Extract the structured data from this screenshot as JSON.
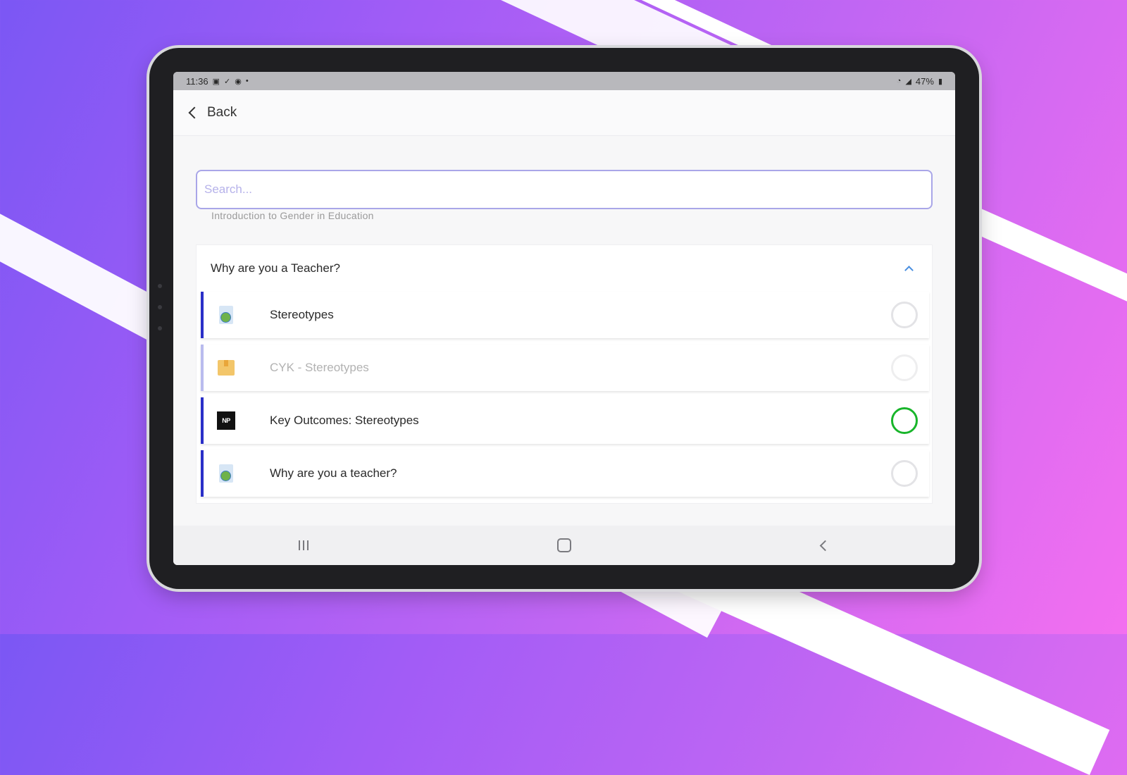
{
  "status_bar": {
    "time": "11:36",
    "battery": "47%"
  },
  "header": {
    "back_label": "Back"
  },
  "search": {
    "placeholder": "Search..."
  },
  "faded_previous_item": "Introduction to Gender in Education",
  "section": {
    "title": "Why are you a Teacher?",
    "items": [
      {
        "label": "Stereotypes",
        "icon": "document-icon",
        "selected": false,
        "dimmed": false
      },
      {
        "label": "CYK - Stereotypes",
        "icon": "package-icon",
        "selected": false,
        "dimmed": true
      },
      {
        "label": "Key Outcomes: Stereotypes",
        "icon": "video-icon",
        "icon_text": "NP",
        "selected": true,
        "dimmed": false
      },
      {
        "label": "Why are you a teacher?",
        "icon": "document-icon",
        "selected": false,
        "dimmed": false
      }
    ]
  },
  "colors": {
    "accent_border": "#2a2fc8",
    "selected_ring": "#18b52a",
    "search_border": "#a9a6e8"
  }
}
